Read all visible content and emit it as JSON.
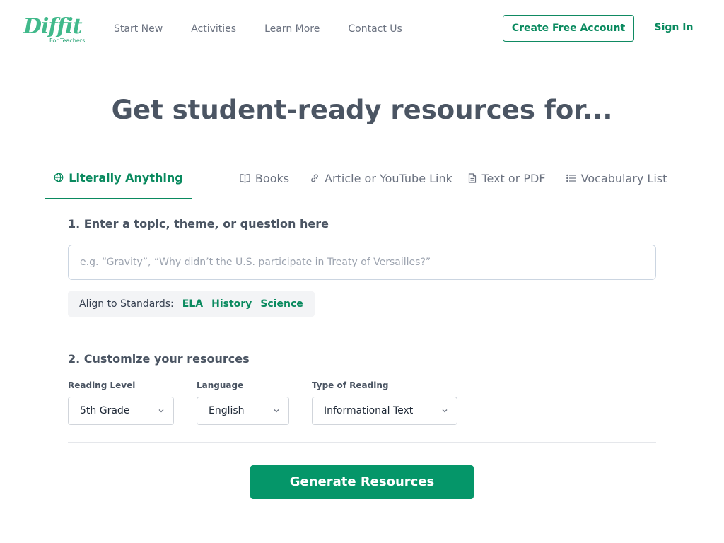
{
  "header": {
    "logo_text": "Diffit",
    "logo_subtext": "For Teachers",
    "nav": [
      "Start New",
      "Activities",
      "Learn More",
      "Contact Us"
    ],
    "create_account_label": "Create Free Account",
    "sign_in_label": "Sign In"
  },
  "headline": "Get student-ready resources for...",
  "tabs": [
    {
      "label": "Literally Anything",
      "icon": "globe-icon",
      "active": true
    },
    {
      "label": "Books",
      "icon": "book-icon",
      "active": false
    },
    {
      "label": "Article or YouTube Link",
      "icon": "link-icon",
      "active": false
    },
    {
      "label": "Text or PDF",
      "icon": "document-icon",
      "active": false
    },
    {
      "label": "Vocabulary List",
      "icon": "list-icon",
      "active": false
    }
  ],
  "step1": {
    "title": "1. Enter a topic, theme, or question here",
    "input_value": "",
    "input_placeholder": "e.g. “Gravity”, “Why didn’t the U.S. participate in Treaty of Versailles?”",
    "standards_label": "Align to Standards:",
    "standards": [
      "ELA",
      "History",
      "Science"
    ]
  },
  "step2": {
    "title": "2. Customize your resources",
    "reading_level": {
      "label": "Reading Level",
      "value": "5th Grade"
    },
    "language": {
      "label": "Language",
      "value": "English"
    },
    "reading_type": {
      "label": "Type of Reading",
      "value": "Informational Text"
    }
  },
  "generate_label": "Generate Resources",
  "colors": {
    "brand": "#059669",
    "brand_text": "#0a8a5f",
    "logo": "#41b98b",
    "heading": "#4b5563",
    "muted": "#6b7280"
  }
}
